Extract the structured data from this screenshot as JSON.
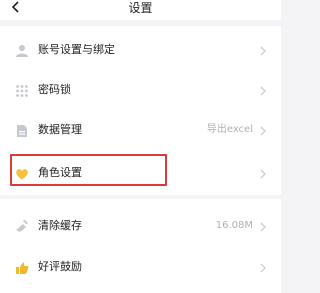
{
  "header": {
    "title": "设置",
    "back_icon": "chevron-left-icon"
  },
  "group1": [
    {
      "label": "账号设置与绑定",
      "icon": "person-icon",
      "value": ""
    },
    {
      "label": "密码锁",
      "icon": "grid-dots-icon",
      "value": ""
    },
    {
      "label": "数据管理",
      "icon": "document-icon",
      "value": "导出excel"
    },
    {
      "label": "角色设置",
      "icon": "heart-icon",
      "value": ""
    }
  ],
  "group2": [
    {
      "label": "清除缓存",
      "icon": "broom-icon",
      "value": "16.08M"
    },
    {
      "label": "好评鼓励",
      "icon": "thumbs-up-icon",
      "value": ""
    }
  ],
  "colors": {
    "highlight": "#d93a3a",
    "heart": "#f6c23e",
    "thumb": "#f3b829",
    "icon_gray": "#c7c9d0"
  }
}
